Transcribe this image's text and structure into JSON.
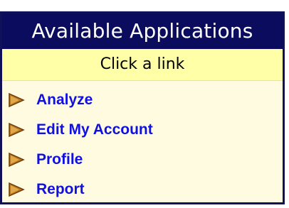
{
  "panel": {
    "title": "Available Applications",
    "subtitle": "Click a link",
    "links": [
      {
        "label": "Analyze",
        "icon": "arrow-right-icon"
      },
      {
        "label": "Edit My Account",
        "icon": "arrow-right-icon"
      },
      {
        "label": "Profile",
        "icon": "arrow-right-icon"
      },
      {
        "label": "Report",
        "icon": "arrow-right-icon"
      }
    ]
  },
  "colors": {
    "header_bg": "#0c0c5e",
    "subheader_bg": "#ffffa8",
    "panel_bg": "#fffbe0",
    "link": "#1010e0",
    "arrow": "#9a5a10"
  }
}
